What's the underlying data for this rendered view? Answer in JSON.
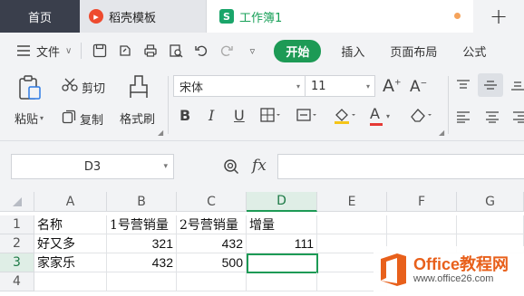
{
  "tabs": [
    {
      "label": "首页"
    },
    {
      "label": "稻壳模板"
    },
    {
      "label": "工作簿1"
    }
  ],
  "menu": {
    "file_label": "文件",
    "start_label": "开始",
    "insert_label": "插入",
    "page_layout_label": "页面布局",
    "formula_label": "公式"
  },
  "ribbon": {
    "paste_label": "粘贴",
    "cut_label": "剪切",
    "copy_label": "复制",
    "format_painter_label": "格式刷",
    "font_name": "宋体",
    "font_size": "11"
  },
  "formula_bar": {
    "name_box": "D3",
    "fx_label": "fx"
  },
  "sheet": {
    "columns": [
      "A",
      "B",
      "C",
      "D",
      "E",
      "F",
      "G"
    ],
    "rows": [
      "1",
      "2",
      "3",
      "4"
    ],
    "cells": {
      "A1": "名称",
      "B1": "1号营销量",
      "C1": "2号营销量",
      "D1": "增量",
      "A2": "好又多",
      "B2": "321",
      "C2": "432",
      "D2": "111",
      "A3": "家家乐",
      "B3": "432",
      "C3": "500",
      "D3": ""
    },
    "active_cell": "D3",
    "accent_color": "#1d9a55"
  },
  "watermark": {
    "title_latin": "Office",
    "title_cn": "教程网",
    "url": "www.office26.com"
  }
}
